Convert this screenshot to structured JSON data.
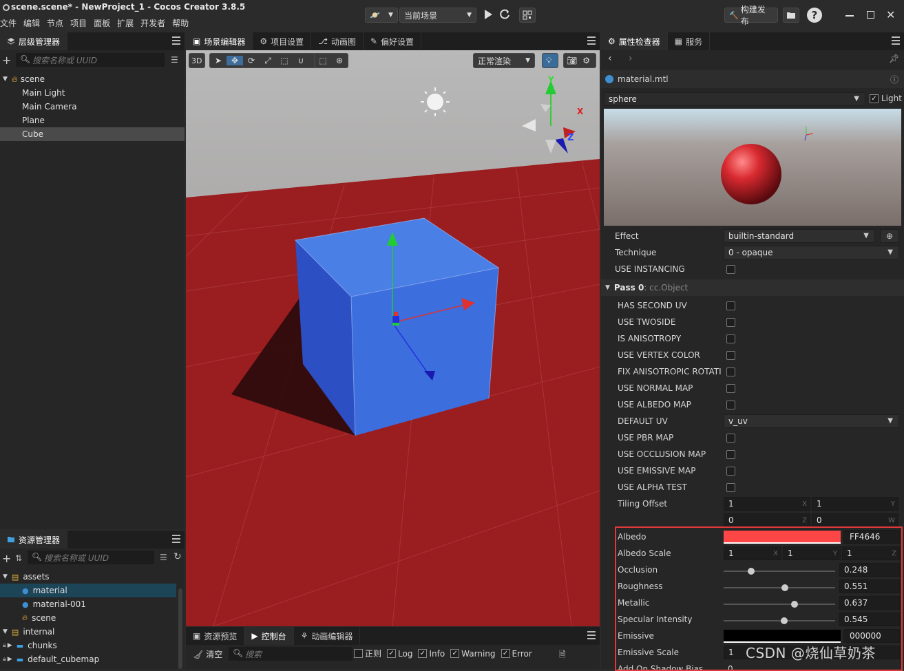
{
  "window": {
    "title": "scene.scene* - NewProject_1 - Cocos Creator 3.8.5",
    "menu": [
      "文件",
      "编辑",
      "节点",
      "项目",
      "面板",
      "扩展",
      "开发者",
      "帮助"
    ],
    "scene_select": "当前场景",
    "build_label": "构建发布"
  },
  "hierarchy": {
    "tab": "层级管理器",
    "search_placeholder": "搜索名称或 UUID",
    "root": "scene",
    "children": [
      "Main Light",
      "Main Camera",
      "Plane",
      "Cube"
    ],
    "selected": "Cube"
  },
  "assets": {
    "tab": "资源管理器",
    "search_placeholder": "搜索名称或 UUID",
    "items": [
      {
        "label": "assets",
        "level": 0,
        "kind": "db"
      },
      {
        "label": "material",
        "level": 1,
        "kind": "material",
        "selected": true
      },
      {
        "label": "material-001",
        "level": 1,
        "kind": "material"
      },
      {
        "label": "scene",
        "level": 1,
        "kind": "scene"
      },
      {
        "label": "internal",
        "level": 0,
        "kind": "db"
      },
      {
        "label": "chunks",
        "level": 1,
        "kind": "folder"
      },
      {
        "label": "default_cubemap",
        "level": 1,
        "kind": "folder"
      }
    ]
  },
  "scene_editor": {
    "tabs": [
      "场景编辑器",
      "项目设置",
      "动画图",
      "偏好设置"
    ],
    "mode_3d": "3D",
    "render_mode": "正常渲染",
    "axis_labels": {
      "x": "X",
      "y": "Y",
      "z": "Z"
    }
  },
  "console": {
    "tabs": [
      "资源预览",
      "控制台",
      "动画编辑器"
    ],
    "clear": "清空",
    "search_placeholder": "搜索",
    "regex": "正则",
    "filters": [
      {
        "label": "Log",
        "checked": true
      },
      {
        "label": "Info",
        "checked": true
      },
      {
        "label": "Warning",
        "checked": true
      },
      {
        "label": "Error",
        "checked": true
      }
    ]
  },
  "inspector": {
    "tabs": [
      "属性检查器",
      "服务"
    ],
    "asset_name": "material.mtl",
    "preview_mesh": "sphere",
    "light_label": "Light",
    "light_checked": true,
    "effect_label": "Effect",
    "effect_value": "builtin-standard",
    "technique_label": "Technique",
    "technique_value": "0 - opaque",
    "instancing_label": "USE INSTANCING",
    "pass_title": "Pass 0",
    "pass_type": " : cc.Object",
    "defines": [
      "HAS SECOND UV",
      "USE TWOSIDE",
      "IS ANISOTROPY",
      "USE VERTEX COLOR",
      "FIX ANISOTROPIC ROTATI",
      "USE NORMAL MAP",
      "USE ALBEDO MAP"
    ],
    "default_uv_label": "DEFAULT UV",
    "default_uv_value": "v_uv",
    "defines2": [
      "USE PBR MAP",
      "USE OCCLUSION MAP",
      "USE EMISSIVE MAP",
      "USE ALPHA TEST"
    ],
    "tiling_label": "Tiling Offset",
    "tiling": [
      {
        "value": "1",
        "axis": "X"
      },
      {
        "value": "1",
        "axis": "Y"
      },
      {
        "value": "0",
        "axis": "Z"
      },
      {
        "value": "0",
        "axis": "W"
      }
    ],
    "albedo_label": "Albedo",
    "albedo_color": "#FF4646",
    "albedo_hex": "FF4646",
    "albedo_scale_label": "Albedo Scale",
    "albedo_scale": [
      {
        "value": "1",
        "axis": "X"
      },
      {
        "value": "1",
        "axis": "Y"
      },
      {
        "value": "1",
        "axis": "Z"
      }
    ],
    "sliders": [
      {
        "label": "Occlusion",
        "value": "0.248",
        "fraction": 0.248
      },
      {
        "label": "Roughness",
        "value": "0.551",
        "fraction": 0.551
      },
      {
        "label": "Metallic",
        "value": "0.637",
        "fraction": 0.637
      },
      {
        "label": "Specular Intensity",
        "value": "0.545",
        "fraction": 0.545
      }
    ],
    "emissive_label": "Emissive",
    "emissive_color": "#000000",
    "emissive_hex": "000000",
    "emissive_scale_label": "Emissive Scale",
    "emissive_scale_value": "1",
    "shadow_bias_label": "Add On Shadow Bias",
    "shadow_bias_value": "0"
  },
  "watermark": "CSDN @烧仙草奶茶",
  "colors": {
    "accent": "#1d4558",
    "highlight_box": "#e0393b",
    "floor": "#9a1d20",
    "cube": "#3a6fd8"
  }
}
